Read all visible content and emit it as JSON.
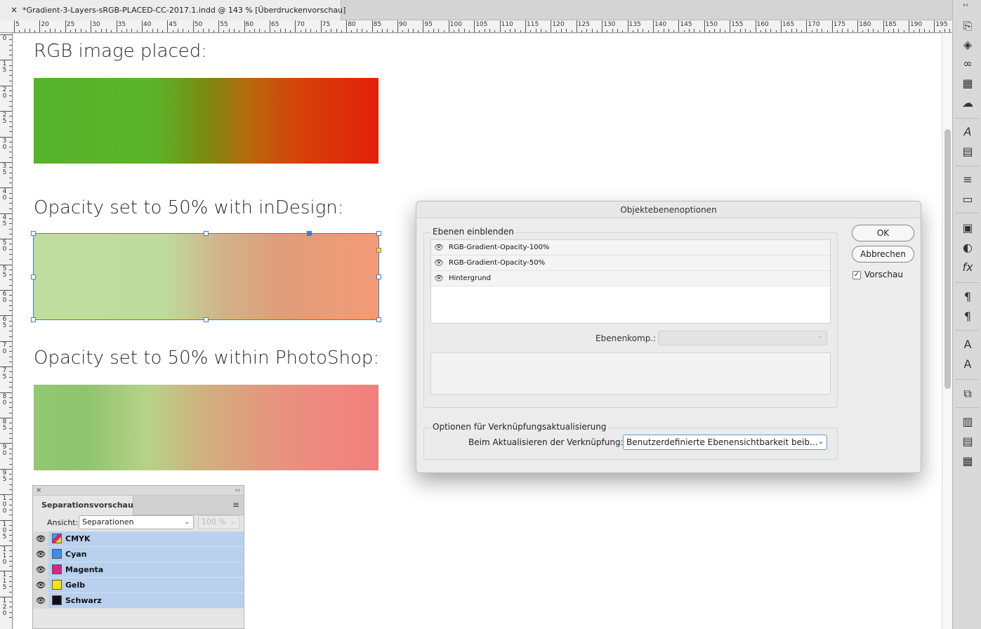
{
  "document_tab": {
    "close_glyph": "×",
    "title": "*Gradient-3-Layers-sRGB-PLACED-CC-2017.1.indd @ 143 % [Überdruckenvorschau]"
  },
  "rulers": {
    "horizontal": [
      "5",
      "20",
      "25",
      "30",
      "35",
      "40",
      "45",
      "50",
      "55",
      "60",
      "65",
      "70",
      "75",
      "80",
      "85",
      "90",
      "95",
      "100",
      "105",
      "110",
      "115",
      "120",
      "125",
      "130",
      "135",
      "140",
      "145",
      "150",
      "155",
      "160",
      "165",
      "170",
      "175",
      "180",
      "185",
      "190",
      "195"
    ],
    "vertical": [
      "0",
      "1\n5",
      "2\n0",
      "2\n5",
      "3\n0",
      "3\n5",
      "4\n0",
      "4\n5",
      "5\n0",
      "5\n5",
      "6\n0",
      "6\n5",
      "7\n0",
      "7\n5",
      "8\n0",
      "8\n5",
      "9\n0",
      "9\n5",
      "1\n0\n0",
      "1\n0\n5",
      "1\n1\n0",
      "1\n1\n5",
      "1\n2\n0"
    ]
  },
  "canvas": {
    "heading1": "RGB image placed:",
    "heading2": "Opacity set to 50% with inDesign:",
    "heading3": "Opacity set to 50% within PhotoShop:",
    "selection_color": "#3d7fd9"
  },
  "dialog": {
    "title": "Objektebenenoptionen",
    "show_layers_label": "Ebenen einblenden",
    "layers": [
      {
        "name": "RGB-Gradient-Opacity-100%",
        "visible": true
      },
      {
        "name": "RGB-Gradient-Opacity-50%",
        "visible": true
      },
      {
        "name": "Hintergrund",
        "visible": true
      }
    ],
    "layer_comp_label": "Ebenenkomp.:",
    "layer_comp_value": "",
    "link_update_group_label": "Optionen für Verknüpfungsaktualisierung",
    "link_update_label": "Beim Aktualisieren der Verknüpfung:",
    "link_update_value": "Benutzerdefinierte Ebenensichtbarkeit beib...",
    "ok_label": "OK",
    "cancel_label": "Abbrechen",
    "preview_label": "Vorschau",
    "preview_checked": true
  },
  "separations_panel": {
    "tab_label": "Separationsvorschau",
    "view_label": "Ansicht:",
    "view_value": "Separationen",
    "zoom_value": "100 %",
    "separations": [
      {
        "name": "CMYK",
        "color": "cmyk"
      },
      {
        "name": "Cyan",
        "color": "#3d8ee6"
      },
      {
        "name": "Magenta",
        "color": "#e0208a"
      },
      {
        "name": "Gelb",
        "color": "#f5e800"
      },
      {
        "name": "Schwarz",
        "color": "#111111"
      }
    ]
  },
  "right_toolbar": {
    "collapse_glyph": "‹‹",
    "icons": [
      "pages-icon",
      "layers-icon",
      "links-icon",
      "swatches-grid-icon",
      "cc-libraries-icon",
      "character-styles-icon",
      "text-wrap-icon",
      "stroke-icon",
      "gradient-icon",
      "paragraph-styles-icon",
      "color-icon",
      "effects-icon",
      "paragraph-icon",
      "paragraph-styles-2-icon",
      "character-icon",
      "character-styles-2-icon",
      "transform-icon",
      "table-icon",
      "table-styles-icon",
      "cell-styles-icon"
    ]
  }
}
